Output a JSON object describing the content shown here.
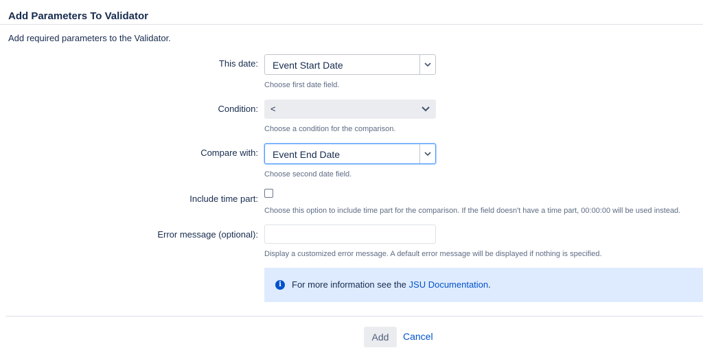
{
  "dialog": {
    "title": "Add Parameters To Validator",
    "description": "Add required parameters to the Validator."
  },
  "fields": {
    "this_date": {
      "label": "This date:",
      "value": "Event Start Date",
      "help": "Choose first date field.",
      "icon": "chevron-down-icon"
    },
    "condition": {
      "label": "Condition:",
      "value": "<",
      "help": "Choose a condition for the comparison.",
      "icon": "chevron-down-icon"
    },
    "compare_with": {
      "label": "Compare with:",
      "value": "Event End Date",
      "help": "Choose second date field.",
      "icon": "chevron-down-icon"
    },
    "include_time": {
      "label": "Include time part:",
      "checked": false,
      "help": "Choose this option to include time part for the comparison. If the field doesn't have a time part, 00:00:00 will be used instead."
    },
    "error_message": {
      "label": "Error message (optional):",
      "value": "",
      "help": "Display a customized error message. A default error message will be displayed if nothing is specified."
    }
  },
  "info": {
    "icon": "info-icon",
    "text_before": "For more information see the ",
    "link_text": "JSU Documentation",
    "text_after": "."
  },
  "footer": {
    "add_label": "Add",
    "cancel_label": "Cancel"
  },
  "colors": {
    "link": "#0052cc",
    "info_background": "#deebff",
    "focus_border": "#4c9aff"
  }
}
